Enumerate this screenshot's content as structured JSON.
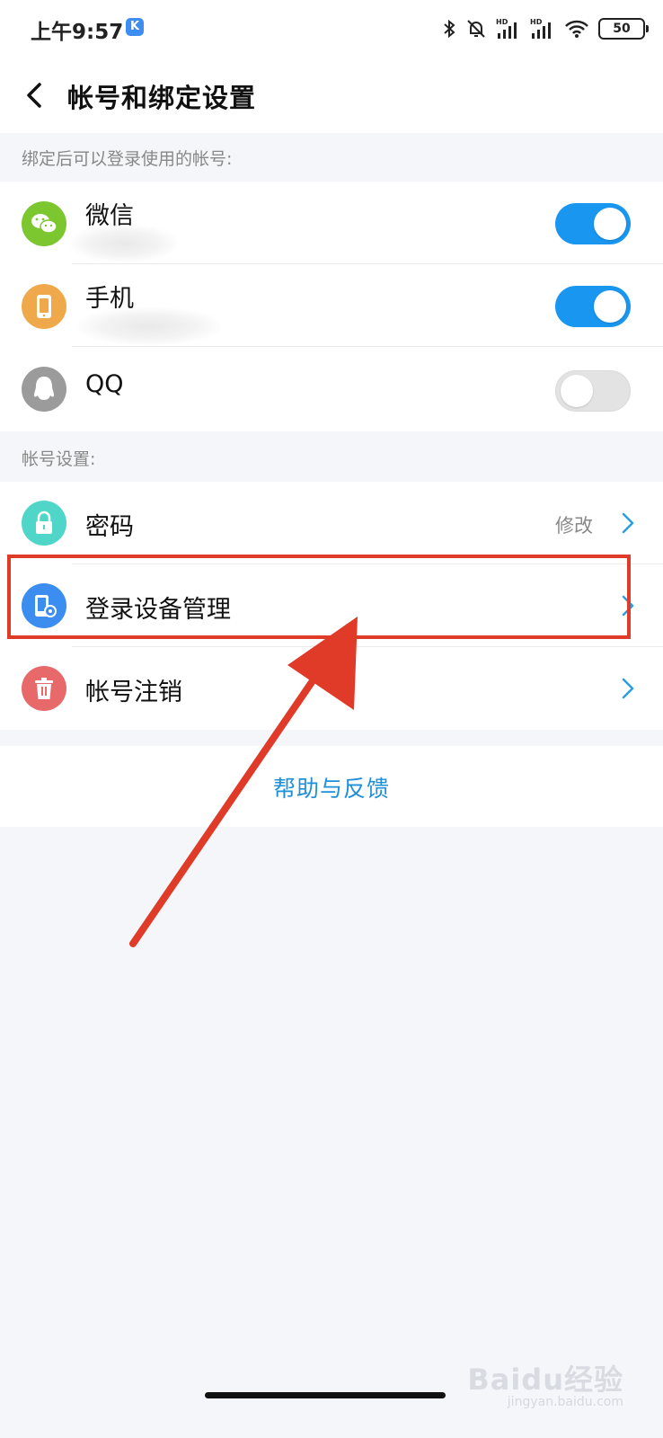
{
  "status_bar": {
    "time": "上午9:57",
    "app_icon_letter": "K",
    "battery": "50",
    "icons": [
      "bluetooth-icon",
      "bell-off-icon",
      "signal-hd-icon",
      "signal-hd-icon",
      "wifi-icon",
      "battery-icon"
    ]
  },
  "header": {
    "title": "帐号和绑定设置",
    "back_icon": "chevron-left-icon"
  },
  "bound_section": {
    "label": "绑定后可以登录使用的帐号:",
    "items": [
      {
        "label": "微信",
        "icon": "wechat-icon",
        "icon_color": "#7cc62f",
        "toggle_on": true
      },
      {
        "label": "手机",
        "icon": "phone-icon",
        "icon_color": "#f0a94a",
        "toggle_on": true
      },
      {
        "label": "QQ",
        "icon": "qq-icon",
        "icon_color": "#9b9b9b",
        "toggle_on": false
      }
    ]
  },
  "account_section": {
    "label": "帐号设置:",
    "items": [
      {
        "label": "密码",
        "value": "修改",
        "icon": "lock-icon",
        "icon_color": "#4fd6c9"
      },
      {
        "label": "登录设备管理",
        "icon": "device-settings-icon",
        "icon_color": "#3b8ef0"
      },
      {
        "label": "帐号注销",
        "icon": "trash-icon",
        "icon_color": "#e8696a"
      }
    ]
  },
  "help": {
    "label": "帮助与反馈"
  },
  "colors": {
    "accent": "#1996f0",
    "annotation": "#e03a28",
    "link": "#1f8fd8"
  },
  "watermark": {
    "text": "Baidu经验",
    "sub": "jingyan.baidu.com"
  }
}
